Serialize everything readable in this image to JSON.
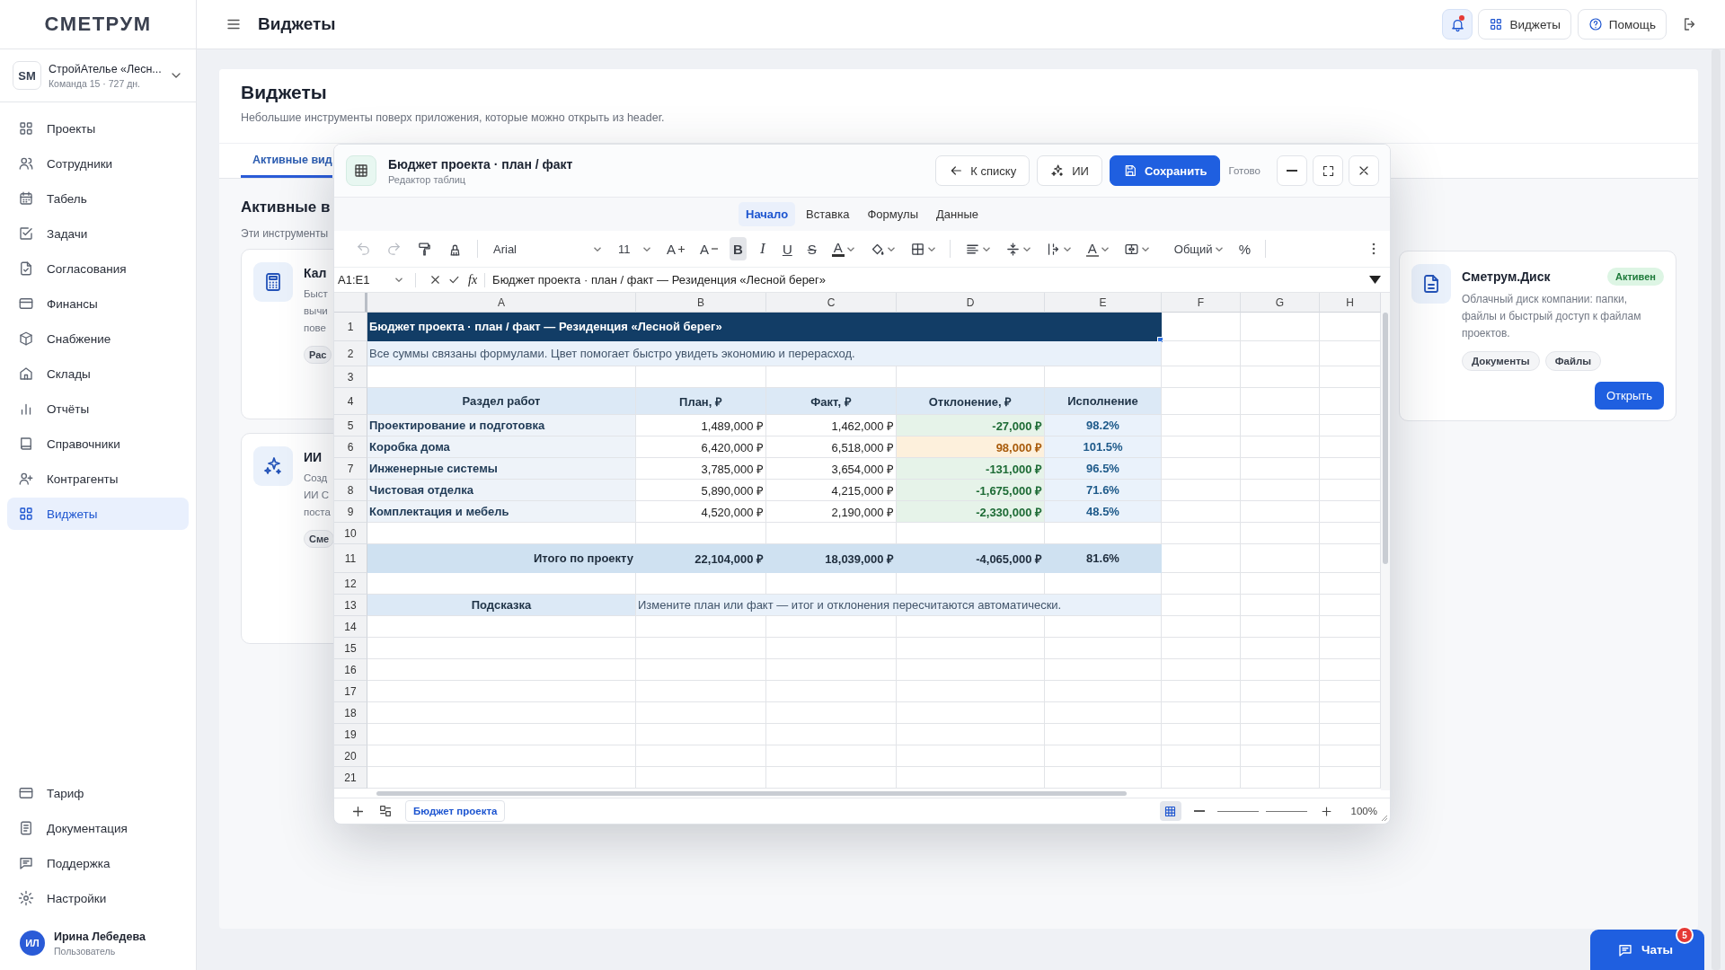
{
  "logo": "СМЕТРУМ",
  "sidebar": {
    "org": {
      "logo": "SM",
      "name": "СтройАтелье «Лесн...",
      "meta": "Команда 15 · 727 дн."
    },
    "items": [
      {
        "label": "Проекты",
        "selected": false
      },
      {
        "label": "Сотрудники",
        "selected": false
      },
      {
        "label": "Табель",
        "selected": false
      },
      {
        "label": "Задачи",
        "selected": false
      },
      {
        "label": "Согласования",
        "selected": false
      },
      {
        "label": "Финансы",
        "selected": false
      },
      {
        "label": "Снабжение",
        "selected": false
      },
      {
        "label": "Склады",
        "selected": false
      },
      {
        "label": "Отчёты",
        "selected": false
      },
      {
        "label": "Справочники",
        "selected": false
      },
      {
        "label": "Контрагенты",
        "selected": false
      },
      {
        "label": "Виджеты",
        "selected": true
      }
    ],
    "bottom_items": [
      {
        "label": "Тариф"
      },
      {
        "label": "Документация"
      },
      {
        "label": "Поддержка"
      },
      {
        "label": "Настройки"
      }
    ],
    "user": {
      "initials": "ИЛ",
      "name": "Ирина Лебедева",
      "role": "Пользователь"
    }
  },
  "header": {
    "title": "Виджеты",
    "notifications": {
      "unread": true
    },
    "buttons": [
      {
        "label": "Виджеты"
      },
      {
        "label": "Помощь"
      }
    ]
  },
  "page": {
    "title": "Виджеты",
    "subtitle": "Небольшие инструменты поверх приложения, которые можно открыть из header.",
    "tabs": [
      {
        "label": "Активные вид",
        "selected": true
      }
    ],
    "section_title": "Активные в",
    "section_subtitle": "Эти инструменты",
    "cards": [
      {
        "title": "Кал",
        "description": [
          "Быст",
          "вычи",
          "пове"
        ],
        "tags": [
          "Рас"
        ]
      },
      {
        "title": "ИИ",
        "description": [
          "Созд",
          "ИИ С",
          "поста"
        ],
        "tags": [
          "Сме"
        ]
      }
    ],
    "side_card": {
      "title": "Сметрум.Диск",
      "badge": "Активен",
      "description": "Облачный диск компании: папки, файлы и быстрый доступ к файлам проектов.",
      "tags": [
        "Документы",
        "Файлы"
      ],
      "action": "Открыть"
    }
  },
  "sheet_window": {
    "title": "Бюджет проекта · план / факт",
    "subtitle": "Редактор таблиц",
    "actions": [
      {
        "kind": "back",
        "label": "К списку"
      },
      {
        "kind": "ai",
        "label": "ИИ"
      },
      {
        "kind": "save",
        "label": "Сохранить"
      }
    ],
    "status": "Готово",
    "ribbon_tabs": [
      {
        "label": "Начало",
        "selected": true
      },
      {
        "label": "Вставка",
        "selected": false
      },
      {
        "label": "Формулы",
        "selected": false
      },
      {
        "label": "Данные",
        "selected": false
      }
    ],
    "toolbar": [
      {
        "kind": "undo",
        "disabled": true
      },
      {
        "kind": "redo",
        "disabled": true
      },
      {
        "kind": "format-painter"
      },
      {
        "kind": "clear-format"
      },
      {
        "kind": "separator"
      },
      {
        "kind": "font",
        "label": "Arial"
      },
      {
        "kind": "size",
        "label": "11"
      },
      {
        "kind": "grow-font",
        "label": "A"
      },
      {
        "kind": "shrink-font",
        "label": "A"
      },
      {
        "kind": "bold",
        "label": "B",
        "selected": true
      },
      {
        "kind": "italic",
        "label": "I",
        "selected": false
      },
      {
        "kind": "underline",
        "label": "U",
        "selected": false
      },
      {
        "kind": "strike",
        "label": "S",
        "selected": false
      },
      {
        "kind": "text-color",
        "label": "A"
      },
      {
        "kind": "fill-color"
      },
      {
        "kind": "borders"
      },
      {
        "kind": "separator"
      },
      {
        "kind": "align"
      },
      {
        "kind": "vertical-align"
      },
      {
        "kind": "text-wrap"
      },
      {
        "kind": "text-rotate",
        "label": "A"
      },
      {
        "kind": "merge"
      },
      {
        "kind": "number-format",
        "label": "Общий"
      },
      {
        "kind": "percent",
        "label": "%"
      },
      {
        "kind": "separator"
      },
      {
        "kind": "more"
      }
    ],
    "formula_bar": {
      "cell": "A1:E1",
      "fx": "fx",
      "formula": "Бюджет проекта · план / факт — Резиденция «Лесной берег»"
    },
    "columns": [
      "A",
      "B",
      "C",
      "D",
      "E",
      "F",
      "G",
      "H"
    ],
    "rows": [
      {
        "number": "1",
        "kind": "title",
        "cells": [
          "Бюджет проекта · план / факт — Резиденция «Лесной берег»"
        ]
      },
      {
        "number": "2",
        "kind": "note",
        "cells": [
          "Все суммы связаны формулами. Цвет помогает быстро увидеть экономию и перерасход."
        ]
      },
      {
        "number": "3",
        "kind": "blank"
      },
      {
        "number": "4",
        "kind": "header",
        "cells": [
          "Раздел работ",
          "План, ₽",
          "Факт, ₽",
          "Отклонение, ₽",
          "Исполнение"
        ]
      },
      {
        "number": "5",
        "kind": "item",
        "over_budget": false,
        "cells": [
          "Проектирование и подготовка",
          "1,489,000 ₽",
          "1,462,000 ₽",
          "-27,000 ₽",
          "98.2%"
        ]
      },
      {
        "number": "6",
        "kind": "item",
        "over_budget": true,
        "cells": [
          "Коробка дома",
          "6,420,000 ₽",
          "6,518,000 ₽",
          "98,000 ₽",
          "101.5%"
        ]
      },
      {
        "number": "7",
        "kind": "item",
        "over_budget": false,
        "cells": [
          "Инженерные системы",
          "3,785,000 ₽",
          "3,654,000 ₽",
          "-131,000 ₽",
          "96.5%"
        ]
      },
      {
        "number": "8",
        "kind": "item",
        "over_budget": false,
        "cells": [
          "Чистовая отделка",
          "5,890,000 ₽",
          "4,215,000 ₽",
          "-1,675,000 ₽",
          "71.6%"
        ]
      },
      {
        "number": "9",
        "kind": "item",
        "over_budget": false,
        "cells": [
          "Комплектация и мебель",
          "4,520,000 ₽",
          "2,190,000 ₽",
          "-2,330,000 ₽",
          "48.5%"
        ]
      },
      {
        "number": "10",
        "kind": "blank"
      },
      {
        "number": "11",
        "kind": "total",
        "cells": [
          "Итого по проекту",
          "22,104,000 ₽",
          "18,039,000 ₽",
          "-4,065,000 ₽",
          "81.6%"
        ]
      },
      {
        "number": "12",
        "kind": "blank"
      },
      {
        "number": "13",
        "kind": "hint",
        "cells": [
          "Подсказка",
          "Измените план или факт — итог и отклонения пересчитаются автоматически."
        ]
      },
      {
        "number": "14",
        "kind": "blank"
      },
      {
        "number": "15",
        "kind": "blank"
      },
      {
        "number": "16",
        "kind": "blank"
      },
      {
        "number": "17",
        "kind": "blank"
      },
      {
        "number": "18",
        "kind": "blank"
      },
      {
        "number": "19",
        "kind": "blank"
      },
      {
        "number": "20",
        "kind": "blank"
      },
      {
        "number": "21",
        "kind": "blank"
      }
    ],
    "sheets": [
      {
        "label": "Бюджет проекта",
        "selected": true
      }
    ],
    "grid_view": {
      "selected": true
    },
    "zoom": {
      "level": 0.5,
      "reading": "100%"
    }
  },
  "chat": {
    "label": "Чаты",
    "badge": "5"
  }
}
